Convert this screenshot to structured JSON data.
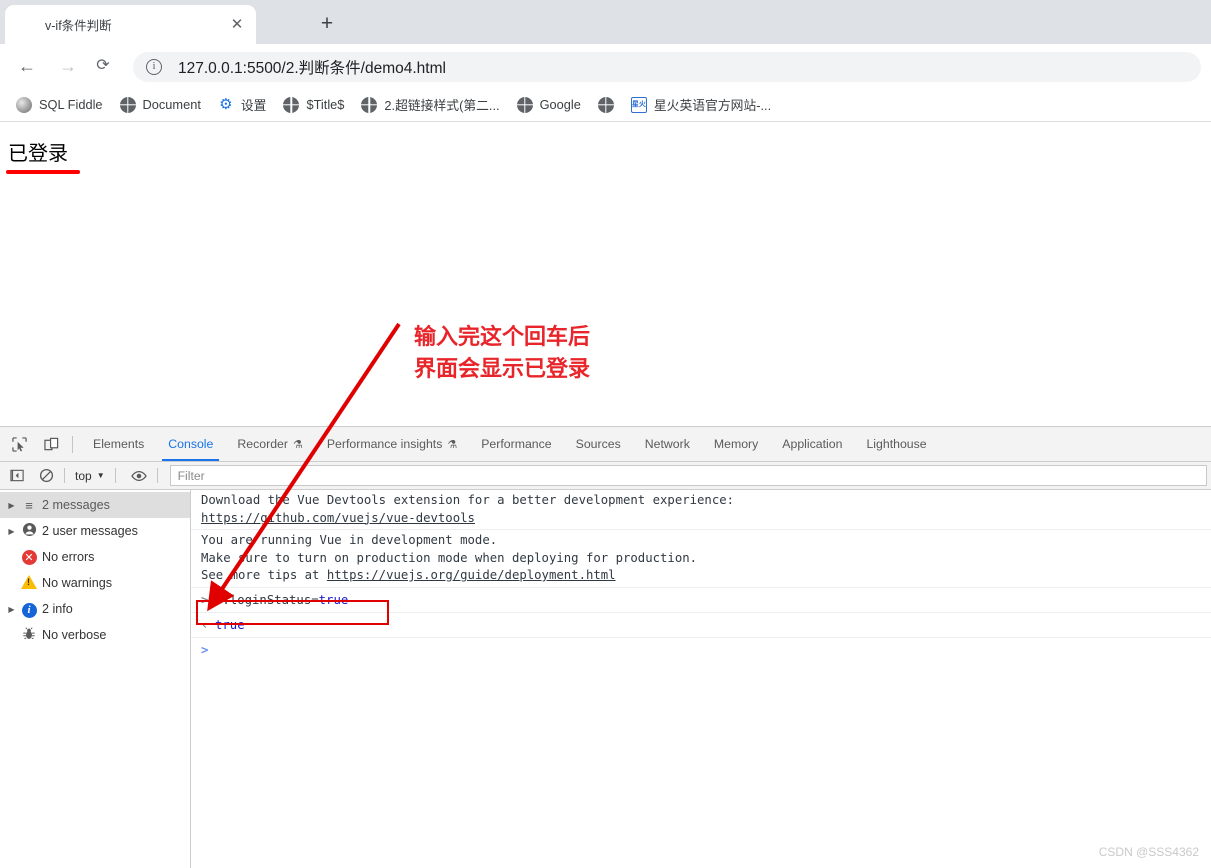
{
  "browser": {
    "tab": {
      "title": "v-if条件判断",
      "favicon": "globe-icon",
      "close_label": "✕"
    },
    "new_tab_label": "+",
    "nav": {
      "back": "←",
      "forward": "→",
      "reload": "⟳"
    },
    "omnibox": {
      "info_glyph": "i",
      "url": "127.0.0.1:5500/2.判断条件/demo4.html"
    },
    "bookmarks": [
      {
        "label": "SQL Fiddle",
        "icon": "sql-fiddle-icon"
      },
      {
        "label": "Document",
        "icon": "globe-icon"
      },
      {
        "label": "设置",
        "icon": "gear-icon"
      },
      {
        "label": "$Title$",
        "icon": "globe-icon"
      },
      {
        "label": "2.超链接样式(第二...",
        "icon": "globe-icon"
      },
      {
        "label": "Google",
        "icon": "globe-icon"
      },
      {
        "label": "",
        "icon": "globe-icon"
      },
      {
        "label": "星火英语官方网站-...",
        "icon": "xinghuo-icon"
      }
    ]
  },
  "page": {
    "heading": "已登录"
  },
  "annotation": {
    "text": "输入完这个回车后\n界面会显示已登录",
    "color": "#e8252a"
  },
  "devtools": {
    "panel_tabs": [
      {
        "label": "Elements",
        "active": false,
        "badge": ""
      },
      {
        "label": "Console",
        "active": true,
        "badge": ""
      },
      {
        "label": "Recorder",
        "active": false,
        "badge": "⚗"
      },
      {
        "label": "Performance insights",
        "active": false,
        "badge": "⚗"
      },
      {
        "label": "Performance",
        "active": false,
        "badge": ""
      },
      {
        "label": "Sources",
        "active": false,
        "badge": ""
      },
      {
        "label": "Network",
        "active": false,
        "badge": ""
      },
      {
        "label": "Memory",
        "active": false,
        "badge": ""
      },
      {
        "label": "Application",
        "active": false,
        "badge": ""
      },
      {
        "label": "Lighthouse",
        "active": false,
        "badge": ""
      }
    ],
    "console_toolbar": {
      "sidebar_toggle": "sidebar-toggle-icon",
      "clear": "clear-console-icon",
      "context": "top",
      "context_caret": "▼",
      "eye": "live-expression-icon",
      "filter_placeholder": "Filter"
    },
    "sidebar": [
      {
        "label": "2 messages",
        "icon": "list-icon",
        "expandable": true,
        "selected": true
      },
      {
        "label": "2 user messages",
        "icon": "user-icon",
        "expandable": true,
        "selected": false
      },
      {
        "label": "No errors",
        "icon": "error-icon",
        "expandable": false,
        "selected": false
      },
      {
        "label": "No warnings",
        "icon": "warning-icon",
        "expandable": false,
        "selected": false
      },
      {
        "label": "2 info",
        "icon": "info-icon",
        "expandable": true,
        "selected": false
      },
      {
        "label": "No verbose",
        "icon": "verbose-bug-icon",
        "expandable": false,
        "selected": false
      }
    ],
    "messages": [
      {
        "line1": "Download the Vue Devtools extension for a better development experience:",
        "link": "https://github.com/vuejs/vue-devtools"
      },
      {
        "line1": "You are running Vue in development mode.",
        "line2": "Make sure to turn on production mode when deploying for production.",
        "line3_prefix": "See more tips at ",
        "link": "https://vuejs.org/guide/deployment.html"
      }
    ],
    "input": {
      "prompt": ">",
      "code_object": "v.loginStatus=",
      "code_value": "true"
    },
    "output": {
      "prompt": "⬅",
      "value": "true"
    },
    "empty_prompt": ">"
  },
  "watermark": "CSDN @SSS4362"
}
